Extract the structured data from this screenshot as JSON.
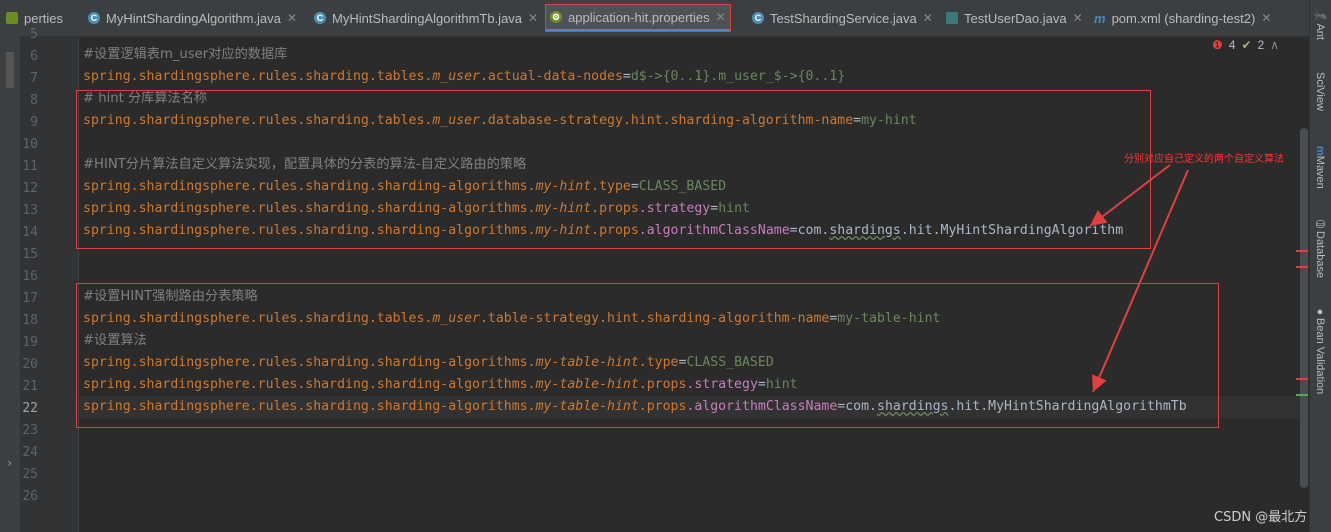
{
  "tabs": [
    {
      "label": "perties",
      "icon": "properties-icon"
    },
    {
      "label": "MyHintShardingAlgorithm.java",
      "icon": "class-icon"
    },
    {
      "label": "MyHintShardingAlgorithmTb.java",
      "icon": "class-icon"
    },
    {
      "label": "application-hit.properties",
      "icon": "properties-icon",
      "active": true
    },
    {
      "label": "TestShardingService.java",
      "icon": "class-icon"
    },
    {
      "label": "TestUserDao.java",
      "icon": "test-icon"
    },
    {
      "label": "pom.xml (sharding-test2)",
      "icon": "maven-icon"
    }
  ],
  "inspections": {
    "errors": "4",
    "warnings": "2"
  },
  "right_panel": [
    "Ant",
    "SciView",
    "Maven",
    "Database",
    "Bean Validation"
  ],
  "line_numbers": [
    "5",
    "6",
    "7",
    "8",
    "9",
    "10",
    "11",
    "12",
    "13",
    "14",
    "15",
    "16",
    "17",
    "18",
    "19",
    "20",
    "21",
    "22",
    "23",
    "24",
    "25",
    "26"
  ],
  "code": {
    "l6": "#设置逻辑表m_user对应的数据库",
    "l7_prefix": "spring.shardingsphere.rules.sharding.tables.",
    "l7_table": "m_user",
    "l7_key": ".actual-data-nodes",
    "l7_eq": "=",
    "l7_val": "d$->{0..1}.m_user_$->{0..1}",
    "l8": "# hint 分库算法名称",
    "l9_prefix": "spring.shardingsphere.rules.sharding.tables.",
    "l9_table": "m_user",
    "l9_key": ".database-strategy.hint.sharding-algorithm-name",
    "l9_eq": "=",
    "l9_val": "my-hint",
    "l11": "#HINT分片算法自定义算法实现，配置具体的分表的算法-自定义路由的策略",
    "l12_prefix": "spring.shardingsphere.rules.sharding.sharding-algorithms.",
    "l12_alg": "my-hint",
    "l12_key": ".type",
    "l12_eq": "=",
    "l12_val": "CLASS_BASED",
    "l13_prefix": "spring.shardingsphere.rules.sharding.sharding-algorithms.",
    "l13_alg": "my-hint",
    "l13_props": ".props",
    "l13_key": ".strategy",
    "l13_eq": "=",
    "l13_val": "hint",
    "l14_prefix": "spring.shardingsphere.rules.sharding.sharding-algorithms.",
    "l14_alg": "my-hint",
    "l14_props": ".props",
    "l14_key": ".algorithmClassName",
    "l14_eq": "=",
    "l14_val_a": "com.",
    "l14_val_b": "shardings",
    "l14_val_c": ".hit.MyHintShardingAlgorithm",
    "l17": "#设置HINT强制路由分表策略",
    "l18_prefix": "spring.shardingsphere.rules.sharding.tables.",
    "l18_table": "m_user",
    "l18_key": ".table-strategy.hint.sharding-algorithm-name",
    "l18_eq": "=",
    "l18_val": "my-table-hint",
    "l19": "#设置算法",
    "l20_prefix": "spring.shardingsphere.rules.sharding.sharding-algorithms.",
    "l20_alg": "my-table-hint",
    "l20_key": ".type",
    "l20_eq": "=",
    "l20_val": "CLASS_BASED",
    "l21_prefix": "spring.shardingsphere.rules.sharding.sharding-algorithms.",
    "l21_alg": "my-table-hint",
    "l21_props": ".props",
    "l21_key": ".strategy",
    "l21_eq": "=",
    "l21_val": "hint",
    "l22_prefix": "spring.shardingsphere.rules.sharding.sharding-algorithms.",
    "l22_alg": "my-table-hint",
    "l22_props": ".props",
    "l22_key": ".algorithmClassName",
    "l22_eq": "=",
    "l22_val_a": "com.",
    "l22_val_b": "shardings",
    "l22_val_c": ".hit.MyHintShardingAlgorithmTb"
  },
  "annotation": "分别对应自己定义的两个自定义算法",
  "watermark": "CSDN @最北方",
  "colors": {
    "accent": "#e04040",
    "keyword": "#cc7832",
    "value": "#6a8759",
    "comment": "#808080"
  }
}
